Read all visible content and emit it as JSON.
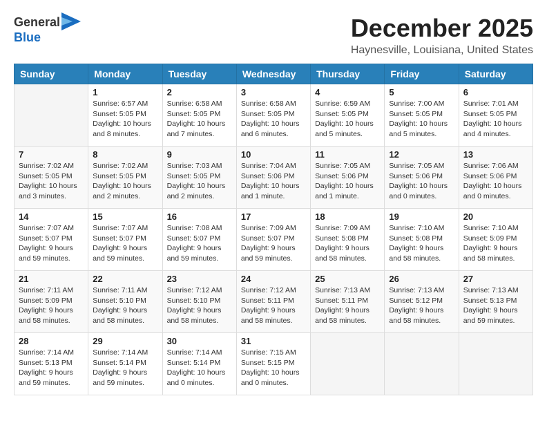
{
  "header": {
    "logo_general": "General",
    "logo_blue": "Blue",
    "month": "December 2025",
    "location": "Haynesville, Louisiana, United States"
  },
  "days_of_week": [
    "Sunday",
    "Monday",
    "Tuesday",
    "Wednesday",
    "Thursday",
    "Friday",
    "Saturday"
  ],
  "weeks": [
    [
      {
        "day": "",
        "info": ""
      },
      {
        "day": "1",
        "info": "Sunrise: 6:57 AM\nSunset: 5:05 PM\nDaylight: 10 hours\nand 8 minutes."
      },
      {
        "day": "2",
        "info": "Sunrise: 6:58 AM\nSunset: 5:05 PM\nDaylight: 10 hours\nand 7 minutes."
      },
      {
        "day": "3",
        "info": "Sunrise: 6:58 AM\nSunset: 5:05 PM\nDaylight: 10 hours\nand 6 minutes."
      },
      {
        "day": "4",
        "info": "Sunrise: 6:59 AM\nSunset: 5:05 PM\nDaylight: 10 hours\nand 5 minutes."
      },
      {
        "day": "5",
        "info": "Sunrise: 7:00 AM\nSunset: 5:05 PM\nDaylight: 10 hours\nand 5 minutes."
      },
      {
        "day": "6",
        "info": "Sunrise: 7:01 AM\nSunset: 5:05 PM\nDaylight: 10 hours\nand 4 minutes."
      }
    ],
    [
      {
        "day": "7",
        "info": "Sunrise: 7:02 AM\nSunset: 5:05 PM\nDaylight: 10 hours\nand 3 minutes."
      },
      {
        "day": "8",
        "info": "Sunrise: 7:02 AM\nSunset: 5:05 PM\nDaylight: 10 hours\nand 2 minutes."
      },
      {
        "day": "9",
        "info": "Sunrise: 7:03 AM\nSunset: 5:05 PM\nDaylight: 10 hours\nand 2 minutes."
      },
      {
        "day": "10",
        "info": "Sunrise: 7:04 AM\nSunset: 5:06 PM\nDaylight: 10 hours\nand 1 minute."
      },
      {
        "day": "11",
        "info": "Sunrise: 7:05 AM\nSunset: 5:06 PM\nDaylight: 10 hours\nand 1 minute."
      },
      {
        "day": "12",
        "info": "Sunrise: 7:05 AM\nSunset: 5:06 PM\nDaylight: 10 hours\nand 0 minutes."
      },
      {
        "day": "13",
        "info": "Sunrise: 7:06 AM\nSunset: 5:06 PM\nDaylight: 10 hours\nand 0 minutes."
      }
    ],
    [
      {
        "day": "14",
        "info": "Sunrise: 7:07 AM\nSunset: 5:07 PM\nDaylight: 9 hours\nand 59 minutes."
      },
      {
        "day": "15",
        "info": "Sunrise: 7:07 AM\nSunset: 5:07 PM\nDaylight: 9 hours\nand 59 minutes."
      },
      {
        "day": "16",
        "info": "Sunrise: 7:08 AM\nSunset: 5:07 PM\nDaylight: 9 hours\nand 59 minutes."
      },
      {
        "day": "17",
        "info": "Sunrise: 7:09 AM\nSunset: 5:07 PM\nDaylight: 9 hours\nand 59 minutes."
      },
      {
        "day": "18",
        "info": "Sunrise: 7:09 AM\nSunset: 5:08 PM\nDaylight: 9 hours\nand 58 minutes."
      },
      {
        "day": "19",
        "info": "Sunrise: 7:10 AM\nSunset: 5:08 PM\nDaylight: 9 hours\nand 58 minutes."
      },
      {
        "day": "20",
        "info": "Sunrise: 7:10 AM\nSunset: 5:09 PM\nDaylight: 9 hours\nand 58 minutes."
      }
    ],
    [
      {
        "day": "21",
        "info": "Sunrise: 7:11 AM\nSunset: 5:09 PM\nDaylight: 9 hours\nand 58 minutes."
      },
      {
        "day": "22",
        "info": "Sunrise: 7:11 AM\nSunset: 5:10 PM\nDaylight: 9 hours\nand 58 minutes."
      },
      {
        "day": "23",
        "info": "Sunrise: 7:12 AM\nSunset: 5:10 PM\nDaylight: 9 hours\nand 58 minutes."
      },
      {
        "day": "24",
        "info": "Sunrise: 7:12 AM\nSunset: 5:11 PM\nDaylight: 9 hours\nand 58 minutes."
      },
      {
        "day": "25",
        "info": "Sunrise: 7:13 AM\nSunset: 5:11 PM\nDaylight: 9 hours\nand 58 minutes."
      },
      {
        "day": "26",
        "info": "Sunrise: 7:13 AM\nSunset: 5:12 PM\nDaylight: 9 hours\nand 58 minutes."
      },
      {
        "day": "27",
        "info": "Sunrise: 7:13 AM\nSunset: 5:13 PM\nDaylight: 9 hours\nand 59 minutes."
      }
    ],
    [
      {
        "day": "28",
        "info": "Sunrise: 7:14 AM\nSunset: 5:13 PM\nDaylight: 9 hours\nand 59 minutes."
      },
      {
        "day": "29",
        "info": "Sunrise: 7:14 AM\nSunset: 5:14 PM\nDaylight: 9 hours\nand 59 minutes."
      },
      {
        "day": "30",
        "info": "Sunrise: 7:14 AM\nSunset: 5:14 PM\nDaylight: 10 hours\nand 0 minutes."
      },
      {
        "day": "31",
        "info": "Sunrise: 7:15 AM\nSunset: 5:15 PM\nDaylight: 10 hours\nand 0 minutes."
      },
      {
        "day": "",
        "info": ""
      },
      {
        "day": "",
        "info": ""
      },
      {
        "day": "",
        "info": ""
      }
    ]
  ]
}
